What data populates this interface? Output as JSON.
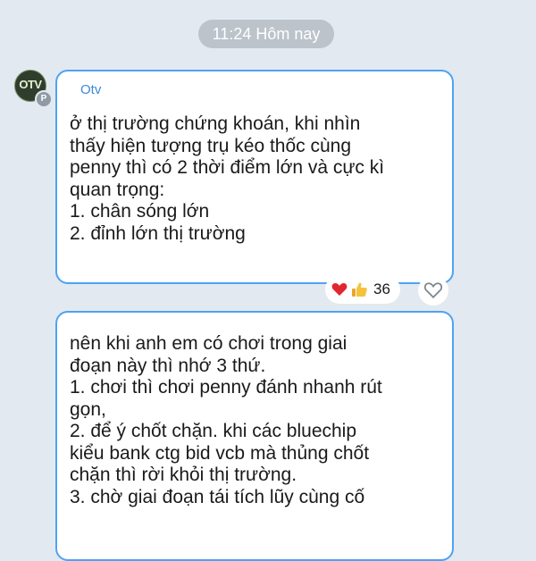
{
  "date_divider": "11:24 Hôm nay",
  "avatar": {
    "initials": "OTV",
    "badge": "P",
    "icon": "channel-avatar-icon"
  },
  "messages": [
    {
      "sender": "Otv",
      "lines": [
        "ở thị trường chứng khoán, khi nhìn",
        "thấy hiện tượng trụ kéo thốc cùng",
        "penny thì có 2 thời điểm lớn và cực kì",
        "quan trọng:",
        "1. chân sóng lớn",
        "2. đỉnh lớn thị trường"
      ],
      "reactions": {
        "icons": [
          "heart-icon",
          "thumbs-up-icon"
        ],
        "count": "36"
      }
    },
    {
      "lines": [
        "nên khi anh em có chơi trong giai",
        "đoạn này thì nhớ 3 thứ.",
        "1. chơi thì chơi penny đánh nhanh rút",
        "gọn,",
        "2. để ý chốt chặn. khi các bluechip",
        "kiểu bank ctg bid vcb mà thủng chốt",
        "chặn thì rời khỏi thị trường.",
        "3. chờ giai đoạn tái tích lũy cùng cố"
      ]
    }
  ],
  "colors": {
    "bubble_border": "#4ea3f1",
    "sender": "#3a8ad8",
    "background": "#e3e9f0"
  }
}
